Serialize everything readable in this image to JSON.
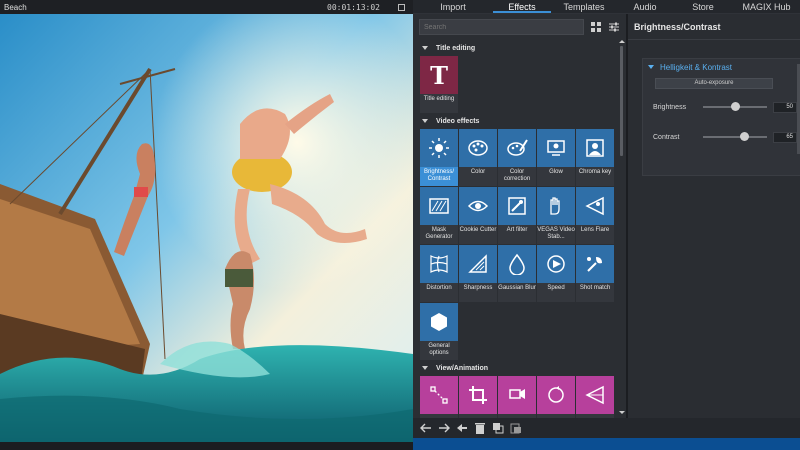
{
  "preview": {
    "title": "Beach",
    "timecode": "00:01:13:02"
  },
  "tabs": [
    {
      "label": "Import"
    },
    {
      "label": "Effects"
    },
    {
      "label": "Templates"
    },
    {
      "label": "Audio"
    },
    {
      "label": "Store"
    },
    {
      "label": "MAGIX Hub"
    }
  ],
  "effects": {
    "search_placeholder": "Search",
    "sections": {
      "title_editing": "Title editing",
      "video_effects": "Video effects",
      "view_animation": "View/Animation"
    },
    "title_tiles": [
      {
        "label": "Title editing",
        "icon": "letter-t-icon"
      }
    ],
    "video_tiles": [
      {
        "label": "Brightness/ Contrast",
        "icon": "sun-icon"
      },
      {
        "label": "Color",
        "icon": "palette-icon"
      },
      {
        "label": "Color correction",
        "icon": "palette-brush-icon"
      },
      {
        "label": "Glow",
        "icon": "lamp-icon"
      },
      {
        "label": "Chroma key",
        "icon": "chroma-key-icon"
      },
      {
        "label": "Mask Generator",
        "icon": "mask-icon"
      },
      {
        "label": "Cookie Cutter",
        "icon": "eye-icon"
      },
      {
        "label": "Art filter",
        "icon": "art-filter-icon"
      },
      {
        "label": "VEGAS Video Stab...",
        "icon": "hand-icon"
      },
      {
        "label": "Lens Flare",
        "icon": "lens-flare-icon"
      },
      {
        "label": "Distortion",
        "icon": "distortion-grid-icon"
      },
      {
        "label": "Sharpness",
        "icon": "sharpness-icon"
      },
      {
        "label": "Gaussian Blur",
        "icon": "drop-icon"
      },
      {
        "label": "Speed",
        "icon": "speed-icon"
      },
      {
        "label": "Shot match",
        "icon": "shot-match-icon"
      },
      {
        "label": "General options",
        "icon": "hexagon-icon"
      }
    ],
    "view_tiles": [
      {
        "icon": "motion-path-icon"
      },
      {
        "icon": "crop-icon"
      },
      {
        "icon": "camera-move-icon"
      },
      {
        "icon": "rotate-icon"
      },
      {
        "icon": "perspective-icon"
      }
    ]
  },
  "properties": {
    "heading": "Brightness/Contrast",
    "group_title": "Helligkeit & Kontrast",
    "auto_button": "Auto-exposure",
    "sliders": [
      {
        "label": "Brightness",
        "value": "50",
        "level": 0.5
      },
      {
        "label": "Contrast",
        "value": "65",
        "level": 0.65
      }
    ]
  },
  "colors": {
    "accent": "#3b8fd6",
    "video_tile": "#2f6fa8",
    "title_tile": "#7e2745",
    "view_tile": "#b7409c",
    "status_strip": "#0b4e92"
  }
}
